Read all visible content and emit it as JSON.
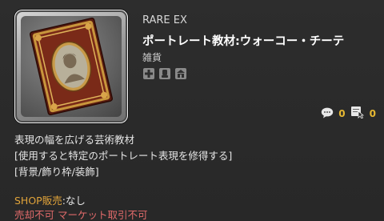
{
  "item": {
    "rarity": "RARE EX",
    "name": "ポートレート教材:ウォーコー・チーテ",
    "category": "雑貨",
    "icon": "portrait-book-icon",
    "attributes": [
      "plus-cross-icon",
      "hand-fist-icon",
      "merchant-icon"
    ]
  },
  "stats": {
    "comments": {
      "icon": "speech-bubble-icon",
      "value": "0"
    },
    "bookmarks": {
      "icon": "notepad-cursor-icon",
      "value": "0"
    }
  },
  "description": {
    "line1": "表現の幅を広げる芸術教材",
    "line2": "[使用すると特定のポートレート表現を修得する]",
    "line3": "[背景/飾り枠/装飾]"
  },
  "shop": {
    "label": "SHOP販売",
    "value": ":なし",
    "trade": "売却不可 マーケット取引不可"
  },
  "colors": {
    "background": "#2a2a2a",
    "accent": "#e7b832",
    "shop_label": "#e0a33a",
    "restriction": "#e06a6a"
  }
}
